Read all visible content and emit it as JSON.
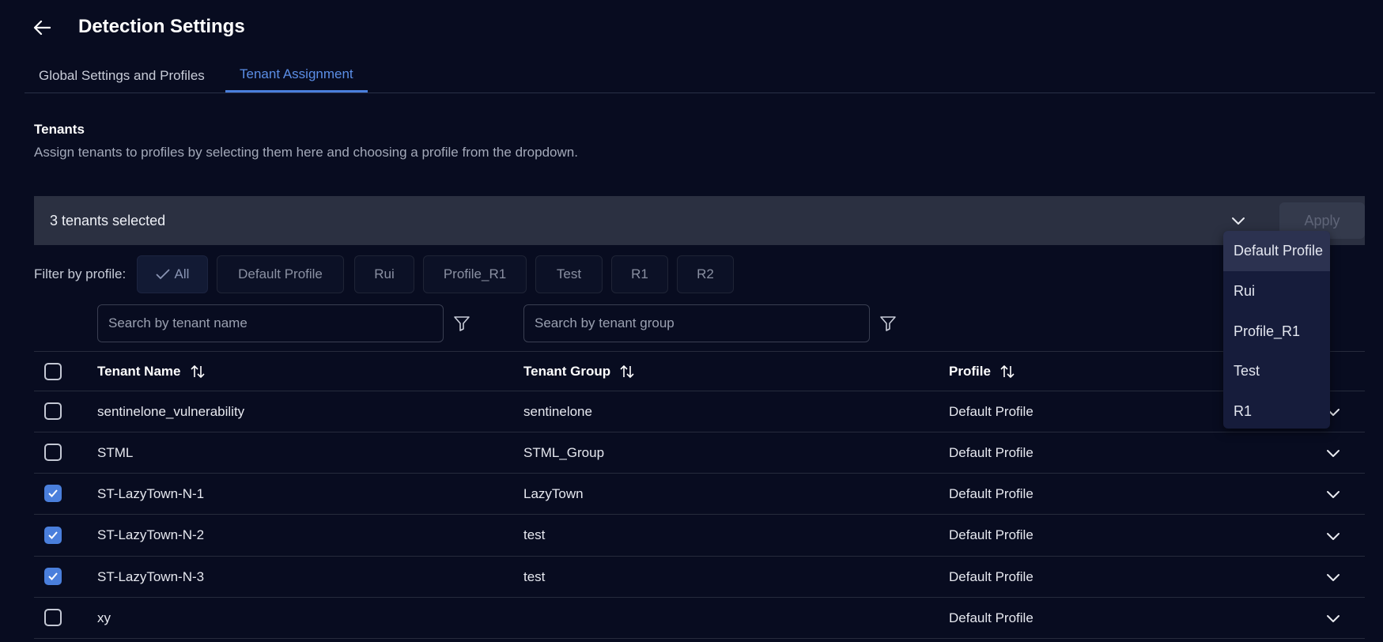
{
  "header": {
    "title": "Detection Settings"
  },
  "tabs": [
    {
      "label": "Global Settings and Profiles",
      "active": false
    },
    {
      "label": "Tenant Assignment",
      "active": true
    }
  ],
  "section": {
    "title": "Tenants",
    "description": "Assign tenants to profiles by selecting them here and choosing a profile from the dropdown."
  },
  "selection_bar": {
    "text": "3 tenants selected",
    "apply_label": "Apply"
  },
  "filter": {
    "label": "Filter by profile:",
    "chips": [
      "All",
      "Default Profile",
      "Rui",
      "Profile_R1",
      "Test",
      "R1",
      "R2"
    ],
    "active": "All"
  },
  "search": {
    "tenant_name_placeholder": "Search by tenant name",
    "tenant_group_placeholder": "Search by tenant group"
  },
  "table": {
    "columns": [
      "Tenant Name",
      "Tenant Group",
      "Profile"
    ],
    "rows": [
      {
        "name": "sentinelone_vulnerability",
        "group": "sentinelone",
        "profile": "Default Profile",
        "checked": false
      },
      {
        "name": "STML",
        "group": "STML_Group",
        "profile": "Default Profile",
        "checked": false
      },
      {
        "name": "ST-LazyTown-N-1",
        "group": "LazyTown",
        "profile": "Default Profile",
        "checked": true
      },
      {
        "name": "ST-LazyTown-N-2",
        "group": "test",
        "profile": "Default Profile",
        "checked": true
      },
      {
        "name": "ST-LazyTown-N-3",
        "group": "test",
        "profile": "Default Profile",
        "checked": true
      },
      {
        "name": "xy",
        "group": "",
        "profile": "Default Profile",
        "checked": false
      }
    ]
  },
  "dropdown": {
    "options": [
      "Default Profile",
      "Rui",
      "Profile_R1",
      "Test",
      "R1"
    ],
    "highlighted": "Default Profile"
  },
  "colors": {
    "accent": "#4a7fdc",
    "background": "#080c20",
    "bar": "#2b3041"
  }
}
